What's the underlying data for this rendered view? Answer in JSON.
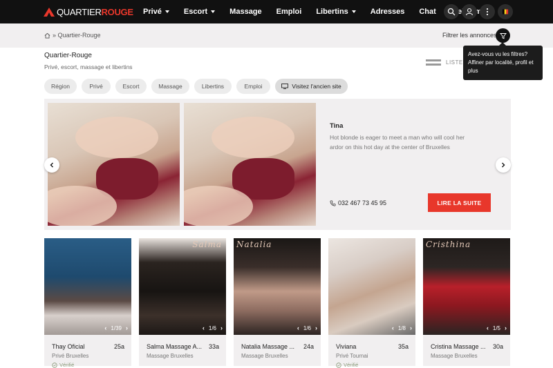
{
  "header": {
    "logo_text_a": "QUARTIER",
    "logo_text_b": "ROUGE",
    "nav": [
      {
        "label": "Privé",
        "dropdown": true
      },
      {
        "label": "Escort",
        "dropdown": true
      },
      {
        "label": "Massage",
        "dropdown": false
      },
      {
        "label": "Emploi",
        "dropdown": false
      },
      {
        "label": "Libertins",
        "dropdown": true
      },
      {
        "label": "Adresses",
        "dropdown": false
      },
      {
        "label": "Chat",
        "dropdown": false
      },
      {
        "label": "Webcam",
        "dropdown": false
      }
    ],
    "icons": [
      "search-icon",
      "user-icon",
      "more-vertical-icon",
      "belgium-flag-icon"
    ]
  },
  "breadcrumb": {
    "separator": "»",
    "current": "Quartier-Rouge"
  },
  "filter": {
    "label": "Filtrer les annonces",
    "tooltip": "Avez-vous vu les filtres? Affiner par localité, profil et plus"
  },
  "page": {
    "title": "Quartier-Rouge",
    "subtitle": "Privé, escort, massage et libertins",
    "view_toggle_label": "LISTE"
  },
  "chips": [
    {
      "label": "Région"
    },
    {
      "label": "Privé"
    },
    {
      "label": "Escort"
    },
    {
      "label": "Massage"
    },
    {
      "label": "Libertins"
    },
    {
      "label": "Emploi"
    },
    {
      "label": "Visitez l'ancien site",
      "icon": "monitor-icon"
    }
  ],
  "featured": {
    "name": "Tina",
    "description": "Hot blonde is eager to meet a man who will cool her ardor on this hot day at the center of Bruxelles",
    "phone": "032 467 73 45 95",
    "cta": "LIRE LA SUITE",
    "accent": "#e8372b"
  },
  "listings": [
    {
      "title": "Thay Oficial",
      "age": "25a",
      "location": "Privé Bruxelles",
      "counter": "1/39",
      "verified": "Vérifié",
      "overlay": ""
    },
    {
      "title": "Salma Massage A...",
      "age": "33a",
      "location": "Massage Bruxelles",
      "counter": "1/6",
      "verified": "",
      "overlay": "Salma"
    },
    {
      "title": "Natalia Massage ...",
      "age": "24a",
      "location": "Massage Bruxelles",
      "counter": "1/6",
      "verified": "",
      "overlay": "Natalia"
    },
    {
      "title": "Viviana",
      "age": "35a",
      "location": "Privé Tournai",
      "counter": "1/8",
      "verified": "Vérifié",
      "overlay": ""
    },
    {
      "title": "Cristina Massage ...",
      "age": "30a",
      "location": "Massage Bruxelles",
      "counter": "1/5",
      "verified": "",
      "overlay": "Cristhina"
    }
  ]
}
